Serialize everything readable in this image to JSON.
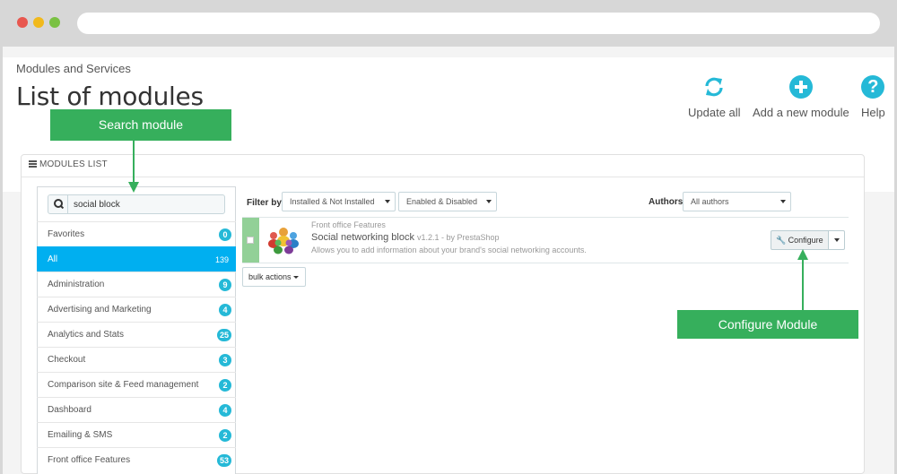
{
  "page": {
    "breadcrumb": "Modules and Services",
    "title": "List of modules"
  },
  "toolbar": {
    "update_label": "Update all",
    "add_label": "Add a new module",
    "help_label": "Help"
  },
  "panel": {
    "heading": "MODULES LIST"
  },
  "search": {
    "value": "social block"
  },
  "categories": [
    {
      "label": "Favorites",
      "count": "0"
    },
    {
      "label": "All",
      "count": "139",
      "active": true
    },
    {
      "label": "Administration",
      "count": "9"
    },
    {
      "label": "Advertising and Marketing",
      "count": "4"
    },
    {
      "label": "Analytics and Stats",
      "count": "25"
    },
    {
      "label": "Checkout",
      "count": "3"
    },
    {
      "label": "Comparison site & Feed management",
      "count": "2"
    },
    {
      "label": "Dashboard",
      "count": "4"
    },
    {
      "label": "Emailing & SMS",
      "count": "2"
    },
    {
      "label": "Front office Features",
      "count": "53"
    }
  ],
  "filters": {
    "filter_by_label": "Filter by",
    "install_select": "Installed & Not Installed",
    "enabled_select": "Enabled & Disabled",
    "authors_label": "Authors",
    "authors_select": "All authors"
  },
  "module": {
    "category": "Front office Features",
    "name": "Social networking block",
    "version": "v1.2.1 - by PrestaShop",
    "description": "Allows you to add information about your brand's social networking accounts.",
    "configure_label": "Configure"
  },
  "bulk_actions_label": "bulk actions",
  "callouts": {
    "search": "Search module",
    "configure": "Configure Module"
  },
  "colors": {
    "accent": "#25b9d7",
    "active_item": "#00aff0",
    "callout": "#36af5c",
    "installed_marker": "#92d097"
  }
}
